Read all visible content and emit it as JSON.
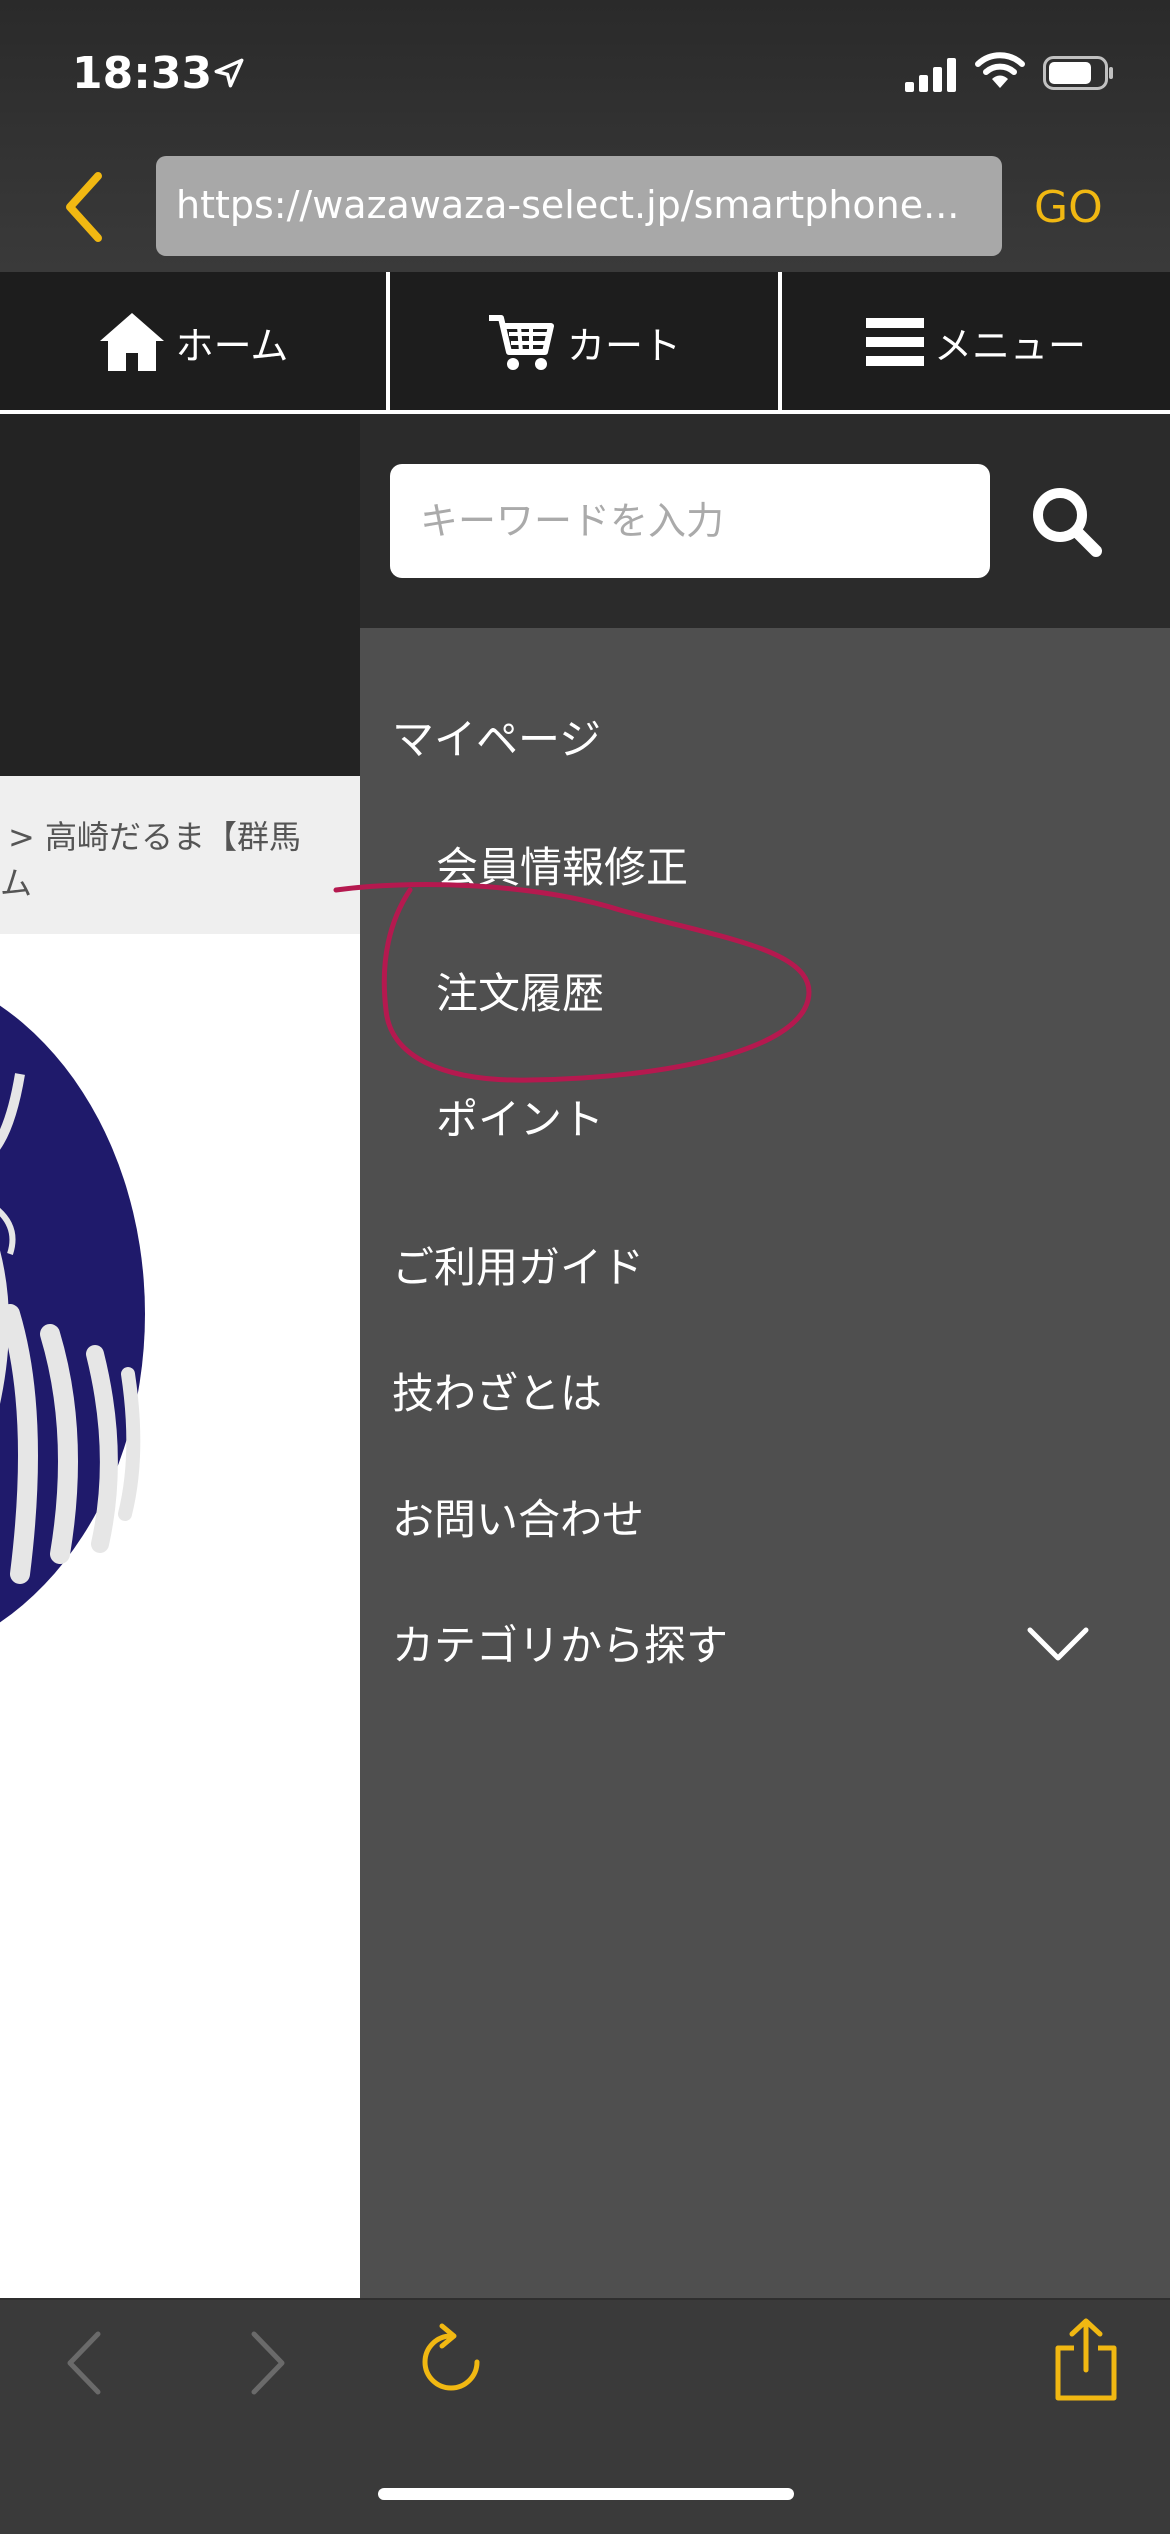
{
  "status_bar": {
    "time": "18:33"
  },
  "browser": {
    "url": "https://wazawaza-select.jp/smartphone...",
    "go_label": "GO"
  },
  "nav": {
    "tabs": [
      {
        "label": "ホーム",
        "icon": "home-icon"
      },
      {
        "label": "カート",
        "icon": "cart-icon"
      },
      {
        "label": "メニュー",
        "icon": "hamburger-menu-icon"
      }
    ]
  },
  "breadcrumb": {
    "line1": "> 高崎だるま【群馬",
    "line2": "ム"
  },
  "search": {
    "placeholder": "キーワードを入力"
  },
  "menu": {
    "mypage": "マイページ",
    "sub_items": [
      "会員情報修正",
      "注文履歴",
      "ポイント"
    ],
    "items": [
      "ご利用ガイド",
      "技わざとは",
      "お問い合わせ"
    ],
    "category": "カテゴリから探す"
  },
  "colors": {
    "accent": "#f1b812",
    "annotation": "#b5194f",
    "daruma_blue": "#1f1a6b"
  }
}
